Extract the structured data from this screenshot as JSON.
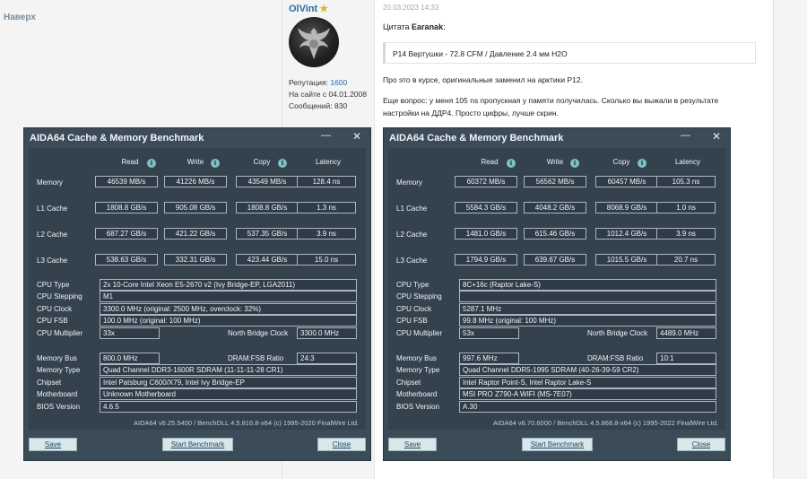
{
  "forum": {
    "back_to_top": "Наверх",
    "author": "OlVint",
    "user_info": {
      "reputation_label": "Репутация: ",
      "reputation_value": "1600",
      "since": "На сайте с 04.01.2008",
      "messages": "Сообщений: 830"
    },
    "post_date": "20.03.2023 14:33",
    "quote_prefix": "Цитата ",
    "quote_author": "Earanak",
    "quote_suffix": ":",
    "quote_text": "P14 Вертушки - 72.8 CFM / Давление 2.4 мм H2O",
    "para1": "Про это в курсе, оригинальные заменил на арктики P12.",
    "para2_line1": "Еще вопрос: у меня 105 ns пропускная у памяти получилась. Сколько вы выжали в результате",
    "para2_line2": "настройки на ДДР4. Просто цифры, лучше скрин."
  },
  "windows": [
    {
      "title": "AIDA64 Cache & Memory Benchmark",
      "min_glyph": "—",
      "close_glyph": "✕",
      "col_headers": [
        "Read",
        "Write",
        "Copy",
        "Latency"
      ],
      "info_glyph": "i",
      "rows": [
        {
          "label": "Memory",
          "read": "46539 MB/s",
          "write": "41226 MB/s",
          "copy": "43549 MB/s",
          "latency": "128.4 ns"
        },
        {
          "label": "L1 Cache",
          "read": "1808.8 GB/s",
          "write": "905.08 GB/s",
          "copy": "1808.8 GB/s",
          "latency": "1.3 ns"
        },
        {
          "label": "L2 Cache",
          "read": "687.27 GB/s",
          "write": "421.22 GB/s",
          "copy": "537.35 GB/s",
          "latency": "3.9 ns"
        },
        {
          "label": "L3 Cache",
          "read": "538.63 GB/s",
          "write": "332.31 GB/s",
          "copy": "423.44 GB/s",
          "latency": "15.0 ns"
        }
      ],
      "cpu": {
        "type_label": "CPU Type",
        "type": "2x 10-Core Intel Xeon E5-2670 v2  (Ivy Bridge-EP, LGA2011)",
        "stepping_label": "CPU Stepping",
        "stepping": "M1",
        "clock_label": "CPU Clock",
        "clock": "3300.0 MHz  (original: 2500 MHz, overclock: 32%)",
        "fsb_label": "CPU FSB",
        "fsb": "100.0 MHz  (original: 100 MHz)",
        "mult_label": "CPU Multiplier",
        "mult": "33x",
        "nb_label": "North Bridge Clock",
        "nb": "3300.0 MHz"
      },
      "mem": {
        "bus_label": "Memory Bus",
        "bus": "800.0 MHz",
        "ratio_label": "DRAM:FSB Ratio",
        "ratio": "24:3",
        "type_label": "Memory Type",
        "type": "Quad Channel DDR3-1600R SDRAM  (11-11-11-28 CR1)",
        "chipset_label": "Chipset",
        "chipset": "Intel Patsburg C600/X79, Intel Ivy Bridge-EP",
        "mb_label": "Motherboard",
        "mb": "Unknown Motherboard",
        "bios_label": "BIOS Version",
        "bios": "4.6.5"
      },
      "footer": "AIDA64 v6.25.5400 / BenchDLL 4.5.816.8-x64  (c) 1995-2020 FinalWire Ltd.",
      "buttons": {
        "save": "Save",
        "start": "Start Benchmark",
        "close": "Close"
      }
    },
    {
      "title": "AIDA64 Cache & Memory Benchmark",
      "min_glyph": "—",
      "close_glyph": "✕",
      "col_headers": [
        "Read",
        "Write",
        "Copy",
        "Latency"
      ],
      "info_glyph": "i",
      "rows": [
        {
          "label": "Memory",
          "read": "60372 MB/s",
          "write": "56562 MB/s",
          "copy": "60457 MB/s",
          "latency": "105.3 ns"
        },
        {
          "label": "L1 Cache",
          "read": "5584.3 GB/s",
          "write": "4048.2 GB/s",
          "copy": "8068.9 GB/s",
          "latency": "1.0 ns"
        },
        {
          "label": "L2 Cache",
          "read": "1481.0 GB/s",
          "write": "615.46 GB/s",
          "copy": "1012.4 GB/s",
          "latency": "3.9 ns"
        },
        {
          "label": "L3 Cache",
          "read": "1794.9 GB/s",
          "write": "639.67 GB/s",
          "copy": "1015.5 GB/s",
          "latency": "20.7 ns"
        }
      ],
      "cpu": {
        "type_label": "CPU Type",
        "type": "8C+16c   (Raptor Lake-S)",
        "stepping_label": "CPU Stepping",
        "stepping": "",
        "clock_label": "CPU Clock",
        "clock": "5287.1 MHz",
        "fsb_label": "CPU FSB",
        "fsb": "99.8 MHz  (original: 100 MHz)",
        "mult_label": "CPU Multiplier",
        "mult": "53x",
        "nb_label": "North Bridge Clock",
        "nb": "4489.0 MHz"
      },
      "mem": {
        "bus_label": "Memory Bus",
        "bus": "997.6 MHz",
        "ratio_label": "DRAM:FSB Ratio",
        "ratio": "10:1",
        "type_label": "Memory Type",
        "type": "Quad Channel DDR5-1995 SDRAM  (40-26-39-59 CR2)",
        "chipset_label": "Chipset",
        "chipset": "Intel Raptor Point-S, Intel Raptor Lake-S",
        "mb_label": "Motherboard",
        "mb": "MSI PRO Z790-A WIFI (MS-7E07)",
        "bios_label": "BIOS Version",
        "bios": "A.30"
      },
      "footer": "AIDA64 v6.70.6000 / BenchDLL 4.5.868.8-x64  (c) 1995-2022 FinalWire Ltd.",
      "buttons": {
        "save": "Save",
        "start": "Start Benchmark",
        "close": "Close"
      }
    }
  ]
}
